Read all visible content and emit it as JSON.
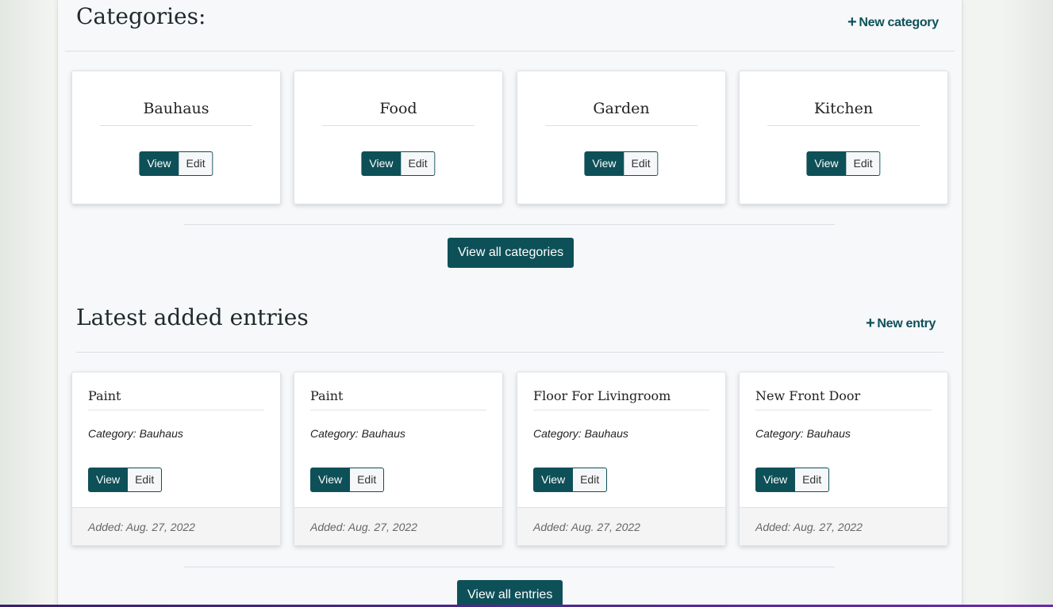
{
  "categories_section": {
    "title": "Categories:",
    "new_label": "New category",
    "items": [
      {
        "name": "Bauhaus"
      },
      {
        "name": "Food"
      },
      {
        "name": "Garden"
      },
      {
        "name": "Kitchen"
      }
    ],
    "view_label": "View",
    "edit_label": "Edit",
    "view_all_label": "View all categories"
  },
  "entries_section": {
    "title": "Latest added entries",
    "new_label": "New entry",
    "items": [
      {
        "title": "Paint",
        "category": "Category: Bauhaus",
        "added": "Added: Aug. 27, 2022"
      },
      {
        "title": "Paint",
        "category": "Category: Bauhaus",
        "added": "Added: Aug. 27, 2022"
      },
      {
        "title": "Floor For Livingroom",
        "category": "Category: Bauhaus",
        "added": "Added: Aug. 27, 2022"
      },
      {
        "title": "New Front Door",
        "category": "Category: Bauhaus",
        "added": "Added: Aug. 27, 2022"
      }
    ],
    "view_label": "View",
    "edit_label": "Edit",
    "view_all_label": "View all entries"
  },
  "colors": {
    "accent": "#0e5058",
    "page_bg": "#f6f8fa",
    "card_footer_bg": "#f4f4f4"
  },
  "icons": {
    "new_category": "plus-icon",
    "new_entry": "plus-icon"
  }
}
